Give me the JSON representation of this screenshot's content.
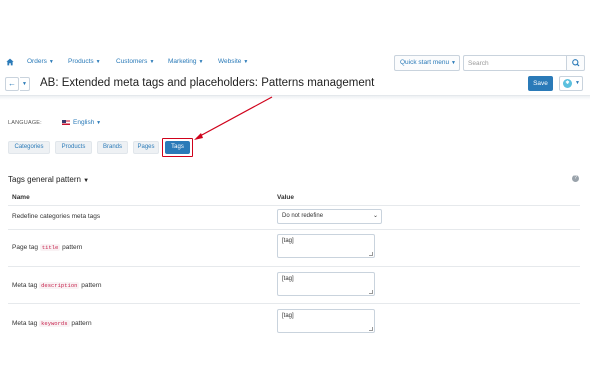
{
  "nav": {
    "home_icon": "home-icon",
    "items": [
      {
        "label": "Orders"
      },
      {
        "label": "Products"
      },
      {
        "label": "Customers"
      },
      {
        "label": "Marketing"
      },
      {
        "label": "Website"
      }
    ],
    "quick_start_label": "Quick start menu",
    "search_placeholder": "Search",
    "search_icon": "search-icon"
  },
  "titlebar": {
    "title": "AB: Extended meta tags and placeholders: Patterns management",
    "save_label": "Save"
  },
  "language": {
    "label": "LANGUAGE:",
    "value": "English"
  },
  "tabs": [
    {
      "label": "Categories"
    },
    {
      "label": "Products"
    },
    {
      "label": "Brands"
    },
    {
      "label": "Pages"
    },
    {
      "label": "Tags",
      "active": true
    }
  ],
  "section": {
    "title": "Tags general pattern"
  },
  "table": {
    "col_name": "Name",
    "col_value": "Value",
    "rows": [
      {
        "prefix": "Redefine categories meta tags",
        "code": "",
        "suffix": "",
        "select_value": "Do not redefine"
      },
      {
        "prefix": "Page tag",
        "code": "title",
        "suffix": "pattern",
        "textarea_value": "[tag]"
      },
      {
        "prefix": "Meta tag",
        "code": "description",
        "suffix": "pattern",
        "textarea_value": "[tag]"
      },
      {
        "prefix": "Meta tag",
        "code": "keywords",
        "suffix": "pattern",
        "textarea_value": "[tag]"
      }
    ]
  },
  "colors": {
    "accent": "#2a7ab8",
    "highlight": "#d0021b"
  }
}
